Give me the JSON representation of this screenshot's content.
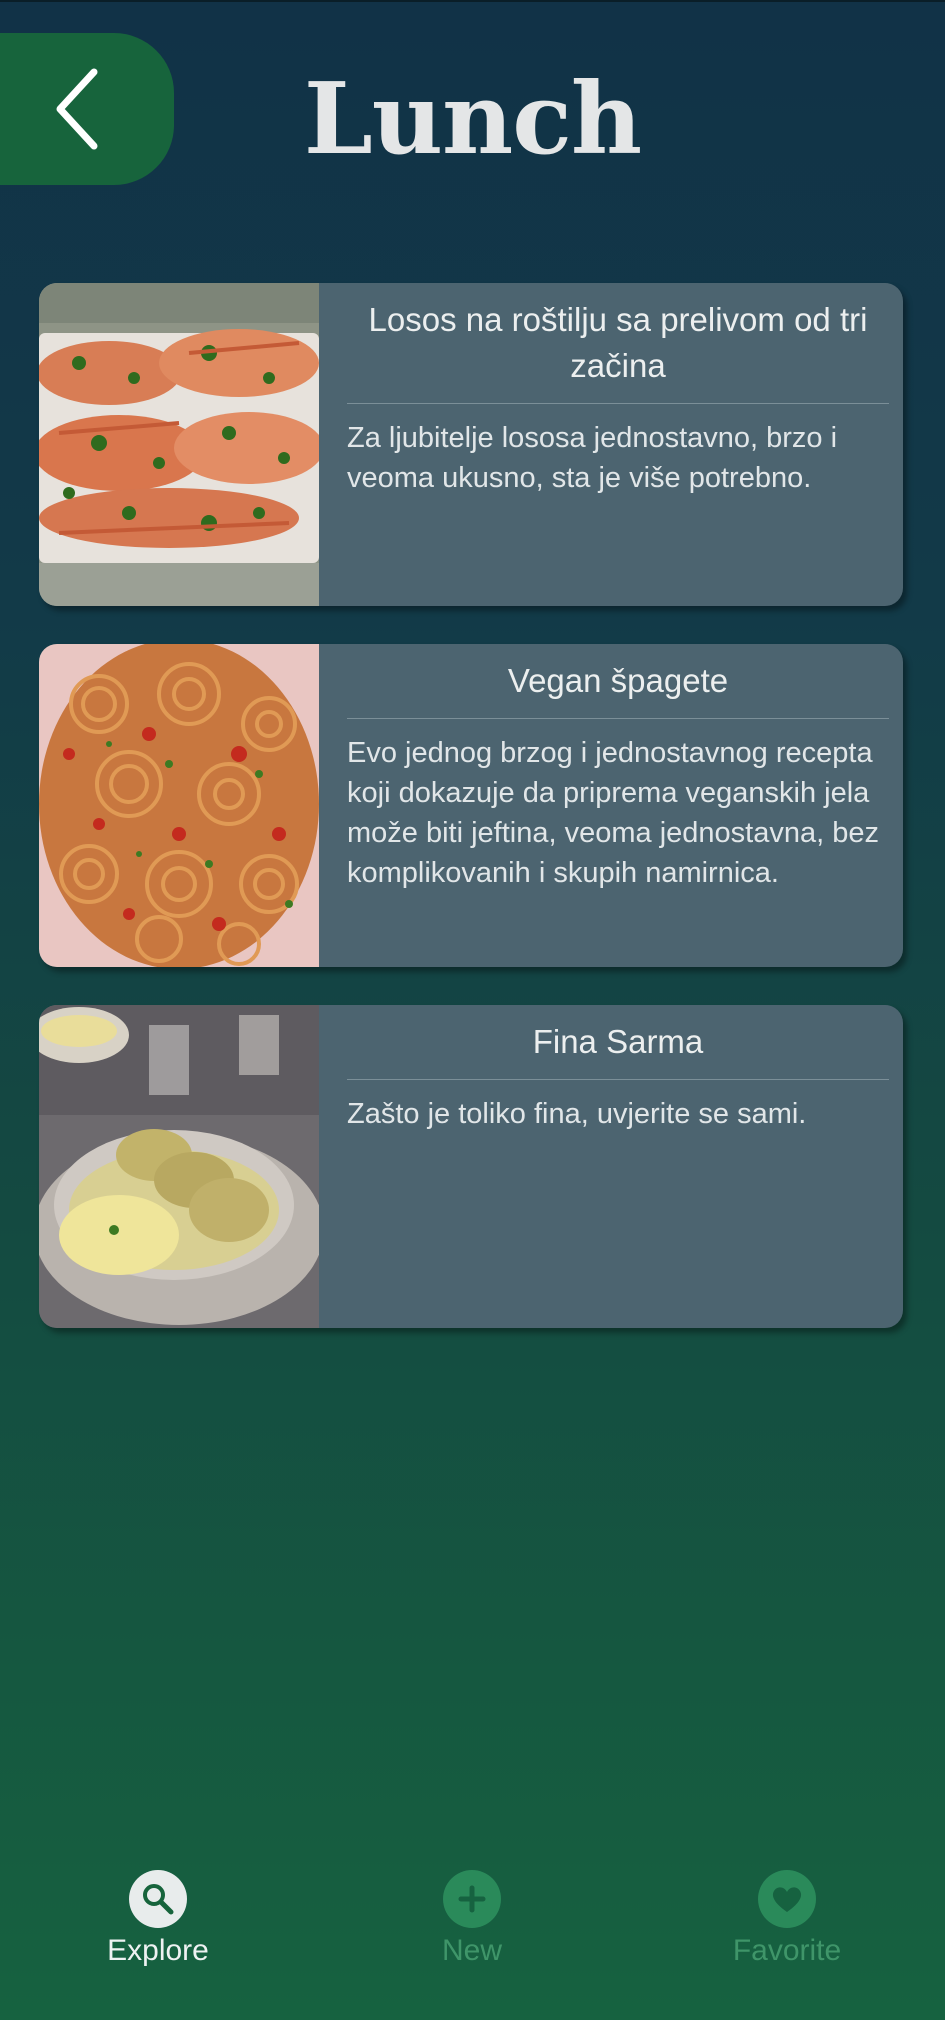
{
  "header": {
    "title": "Lunch",
    "back_icon": "chevron-left-icon"
  },
  "recipes": [
    {
      "title": "Losos na roštilju sa prelivom od tri začina",
      "description": "Za ljubitelje lososa jednostavno, brzo i veoma ukusno, sta je više potrebno.",
      "image": "grilled-salmon-image"
    },
    {
      "title": "Vegan špagete",
      "description": "Evo jednog brzog i jednostavnog recepta koji dokazuje da priprema veganskih jela može biti jeftina, veoma jednostavna, bez komplikovanih i skupih namirnica.",
      "image": "spaghetti-image"
    },
    {
      "title": "Fina Sarma",
      "description": "Zašto je toliko fina, uvjerite se sami.",
      "image": "sarma-image"
    }
  ],
  "nav": {
    "explore": {
      "label": "Explore",
      "icon": "search-icon"
    },
    "new": {
      "label": "New",
      "icon": "plus-icon"
    },
    "favorite": {
      "label": "Favorite",
      "icon": "heart-icon"
    }
  },
  "colors": {
    "background_top": "#113247",
    "background_bottom": "#166240",
    "accent_green": "#17643c",
    "card": "#4c6470",
    "nav_inactive": "#3f9569"
  }
}
